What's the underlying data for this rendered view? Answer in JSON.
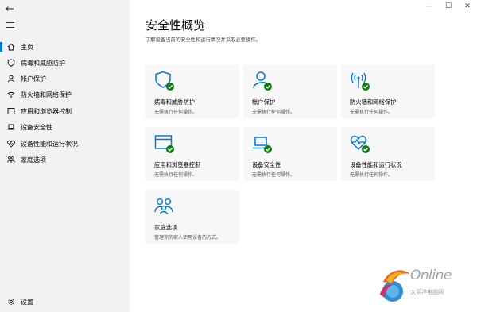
{
  "window": {
    "minimize": "—",
    "maximize": "☐",
    "close": "✕"
  },
  "sidebar": {
    "back": "←",
    "items": [
      {
        "label": "主页",
        "icon": "home-icon",
        "active": true
      },
      {
        "label": "病毒和威胁防护",
        "icon": "shield-icon"
      },
      {
        "label": "帐户保护",
        "icon": "person-icon"
      },
      {
        "label": "防火墙和网络保护",
        "icon": "wifi-icon"
      },
      {
        "label": "应用和浏览器控制",
        "icon": "app-browser-icon"
      },
      {
        "label": "设备安全性",
        "icon": "laptop-icon"
      },
      {
        "label": "设备性能和运行状况",
        "icon": "heart-icon"
      },
      {
        "label": "家庭选项",
        "icon": "family-icon"
      }
    ],
    "settings": {
      "label": "设置",
      "icon": "gear-icon"
    }
  },
  "main": {
    "title": "安全性概览",
    "subtitle": "了解设备当前的安全性和运行情况并采取必要操作。",
    "tiles": [
      {
        "name": "病毒和威胁防护",
        "status": "无需执行任何操作。",
        "icon": "shield-check-icon"
      },
      {
        "name": "帐户保护",
        "status": "无需执行任何操作。",
        "icon": "person-check-icon"
      },
      {
        "name": "防火墙和网络保护",
        "status": "无需执行任何操作。",
        "icon": "antenna-check-icon"
      },
      {
        "name": "应用和浏览器控制",
        "status": "无需执行任何操作。",
        "icon": "browser-check-icon"
      },
      {
        "name": "设备安全性",
        "status": "无需执行任何操作。",
        "icon": "laptop-check-icon"
      },
      {
        "name": "设备性能和运行状况",
        "status": "无需执行任何操作。",
        "icon": "heart-check-icon"
      },
      {
        "name": "家庭选项",
        "status": "管理你的家人使用设备的方式。",
        "icon": "family-icon"
      }
    ]
  },
  "watermark": {
    "text": "Online",
    "sub": "太平洋电脑网"
  },
  "colors": {
    "accent": "#0078d7",
    "ok": "#107c10"
  }
}
